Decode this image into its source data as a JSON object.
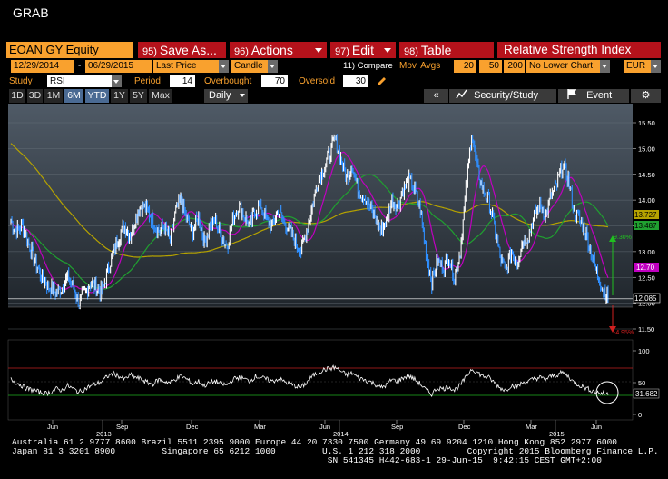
{
  "window": {
    "title": "GRAB"
  },
  "toolbar": {
    "ticker": "EOAN GY Equity",
    "save_num": "95)",
    "save_label": "Save As...",
    "actions_num": "96)",
    "actions_label": "Actions",
    "edit_num": "97)",
    "edit_label": "Edit",
    "table_num": "98)",
    "table_label": "Table",
    "study_title": "Relative Strength Index"
  },
  "params": {
    "start_date": "12/29/2014",
    "end_date": "06/29/2015",
    "price_field": "Last Price",
    "chart_style": "Candle",
    "compare_label": "11) Compare",
    "mov_avgs": "Mov. Avgs",
    "ma1": "20",
    "ma2": "50",
    "ma3": "200",
    "lower_chart": "No Lower Chart",
    "currency": "EUR"
  },
  "study_row": {
    "study_label": "Study",
    "study_value": "RSI",
    "period_label": "Period",
    "period_value": "14",
    "overbought_label": "Overbought",
    "overbought_value": "70",
    "oversold_label": "Oversold",
    "oversold_value": "30"
  },
  "range_tabs": [
    "1D",
    "3D",
    "1M",
    "6M",
    "YTD",
    "1Y",
    "5Y",
    "Max"
  ],
  "active_tabs": [
    "6M",
    "YTD"
  ],
  "frequency": "Daily",
  "right_tools": {
    "collapse": "«",
    "security_study": "Security/Study",
    "event": "Event"
  },
  "price_axis": {
    "ticks": [
      "15.50",
      "15.00",
      "14.50",
      "14.00",
      "13.50",
      "13.00",
      "12.50",
      "12.00",
      "11.50"
    ]
  },
  "price_labels": {
    "ma200": "13.727",
    "ma50": "13.487",
    "ma20": "12.70",
    "last": "12.085",
    "up_pct": "9.30%",
    "down_pct": "-4.95%"
  },
  "rsi_axis": {
    "ticks": [
      "100",
      "50",
      "0"
    ],
    "value": "31.682"
  },
  "date_axis": {
    "labels": [
      "Jun",
      "Sep",
      "Dec",
      "Mar",
      "Jun",
      "Sep",
      "Dec",
      "Mar",
      "Jun"
    ],
    "years": [
      "2013",
      "2014",
      "2015"
    ]
  },
  "colors": {
    "ma20": "#c000c0",
    "ma50": "#20a030",
    "ma200": "#b5a200",
    "price": "#2f8fff",
    "orange": "#f9a12e",
    "red": "#b5121b"
  },
  "chart_data": {
    "type": "candlestick",
    "series": [
      {
        "name": "EOAN GY Equity",
        "values": [
          13.6,
          13.4,
          13.5,
          13.2,
          12.9,
          12.6,
          12.4,
          12.3,
          12.2,
          12.3,
          12.5,
          12.3,
          12.0,
          12.2,
          12.4,
          12.3,
          12.2,
          12.6,
          13.0,
          13.3,
          13.5,
          13.3,
          13.7,
          13.9,
          13.8,
          13.6,
          13.4,
          13.5,
          13.2,
          13.8,
          14.0,
          13.6,
          13.4,
          13.7,
          13.2,
          13.5,
          13.6,
          13.3,
          13.1,
          13.6,
          13.9,
          13.7,
          13.5,
          13.8,
          13.9,
          13.6,
          13.5,
          13.8,
          13.6,
          13.4,
          13.2,
          13.0,
          13.4,
          13.9,
          14.4,
          14.6,
          14.9,
          15.2,
          14.8,
          14.4,
          14.7,
          14.2,
          14.1,
          13.9,
          13.7,
          13.4,
          13.6,
          14.0,
          13.9,
          14.2,
          14.4,
          14.2,
          13.8,
          13.0,
          12.4,
          12.8,
          12.7,
          12.9,
          12.5,
          13.0,
          14.2,
          15.3,
          14.6,
          14.2,
          14.0,
          13.5,
          12.9,
          12.6,
          13.0,
          12.8,
          13.2,
          13.3,
          13.7,
          13.9,
          13.7,
          14.1,
          14.3,
          14.7,
          14.4,
          13.8,
          13.6,
          13.4,
          13.0,
          12.6,
          12.3,
          12.1
        ]
      }
    ],
    "moving_averages": [
      "20",
      "50",
      "200"
    ],
    "ylim": [
      11.4,
      15.7
    ],
    "overbought": 70,
    "oversold": 30,
    "rsi": {
      "values": [
        55,
        50,
        45,
        40,
        38,
        35,
        33,
        35,
        40,
        38,
        45,
        40,
        35,
        40,
        45,
        48,
        52,
        60,
        65,
        60,
        55,
        62,
        58,
        55,
        50,
        48,
        55,
        52,
        50,
        56,
        60,
        55,
        48,
        52,
        45,
        50,
        52,
        48,
        46,
        55,
        58,
        56,
        52,
        60,
        58,
        55,
        52,
        56,
        52,
        48,
        45,
        42,
        50,
        60,
        66,
        70,
        72,
        74,
        68,
        62,
        65,
        58,
        55,
        52,
        48,
        42,
        46,
        55,
        52,
        58,
        60,
        55,
        48,
        38,
        32,
        42,
        40,
        44,
        38,
        46,
        58,
        72,
        66,
        60,
        58,
        50,
        42,
        38,
        46,
        44,
        50,
        52,
        56,
        58,
        55,
        60,
        62,
        66,
        60,
        50,
        46,
        42,
        38,
        35,
        33,
        32
      ],
      "ylim": [
        0,
        100
      ]
    }
  }
}
